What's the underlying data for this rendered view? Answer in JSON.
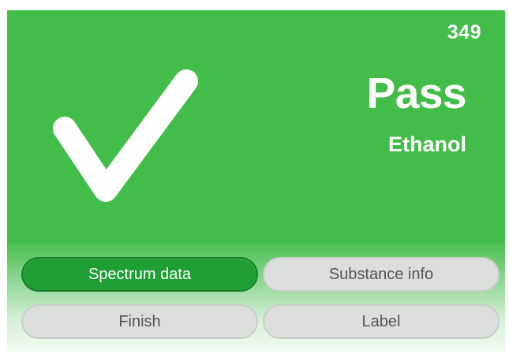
{
  "result": {
    "count": "349",
    "status": "Pass",
    "substance": "Ethanol",
    "icon": "checkmark-icon",
    "status_color": "#43bd49"
  },
  "actions": {
    "spectrum_data": "Spectrum data",
    "substance_info": "Substance info",
    "finish": "Finish",
    "label": "Label"
  },
  "colors": {
    "primary_button": "#1f9e34",
    "secondary_button": "#dcdedc"
  }
}
